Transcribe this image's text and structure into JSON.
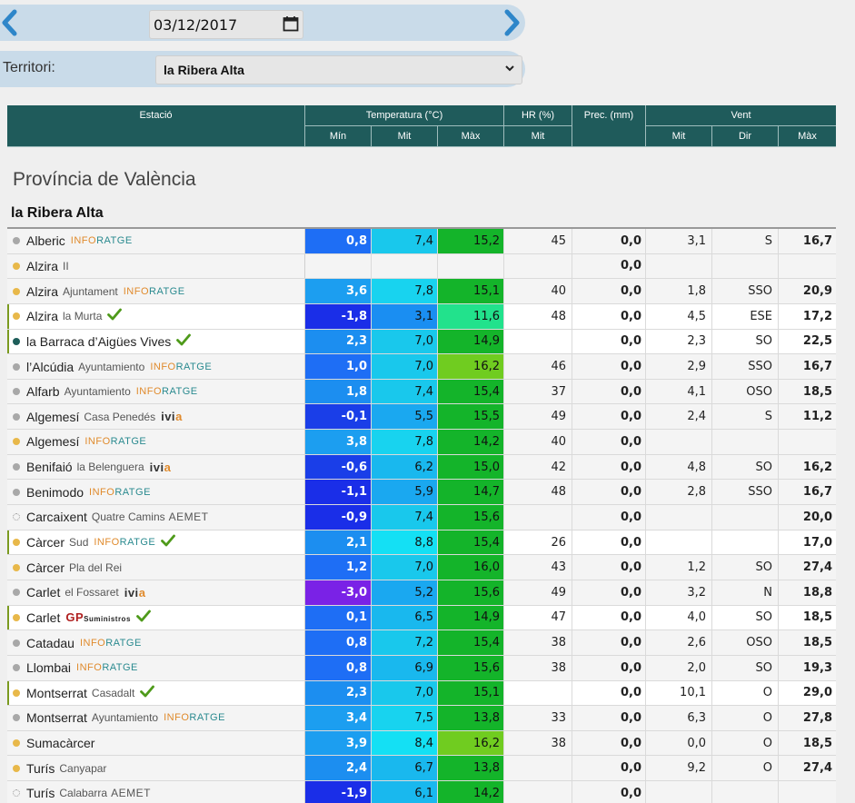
{
  "date": {
    "value": "03/12/2017"
  },
  "territory": {
    "label": "Territori:",
    "value": "la Ribera Alta"
  },
  "table_header": {
    "station": "Estació",
    "temperature": "Temperatura (°C)",
    "humidity": "HR (%)",
    "precip": "Prec. (mm)",
    "wind": "Vent",
    "min": "Mín",
    "mit": "Mit",
    "max": "Màx",
    "hr_mit": "Mit",
    "wind_mit": "Mit",
    "wind_dir": "Dir",
    "wind_max": "Màx"
  },
  "province": "Província de València",
  "comarca": "la Ribera Alta",
  "colors": {
    "header_bg": "#1f5b5b",
    "date_bar_bg": "#c9dbe9",
    "arrow": "#2e86c9",
    "dot_yellow": "#e8b84a",
    "dot_grey": "#a8a8a8",
    "dot_teal": "#1e5e5a",
    "check_green": "#4e9a1a"
  },
  "rows": [
    {
      "name": "Alberic",
      "sub": "",
      "net": "INFORATGE",
      "check": false,
      "hl": false,
      "dot": "grey",
      "tmin": "0,8",
      "tmit": "7,4",
      "tmax": "15,2",
      "hr": "45",
      "prec": "0,0",
      "vmit": "3,1",
      "vdir": "S",
      "vmax": "16,7",
      "cmin": "#1e6ef5",
      "cmit": "#19c8ec",
      "cmax": "#14b42a"
    },
    {
      "name": "Alzira",
      "sub": "II",
      "net": "",
      "check": false,
      "hl": false,
      "dot": "yellow",
      "tmin": "",
      "tmit": "",
      "tmax": "",
      "hr": "",
      "prec": "0,0",
      "vmit": "",
      "vdir": "",
      "vmax": "",
      "cmin": "",
      "cmit": "",
      "cmax": ""
    },
    {
      "name": "Alzira",
      "sub": "Ajuntament",
      "net": "INFORATGE",
      "check": false,
      "hl": false,
      "dot": "yellow",
      "tmin": "3,6",
      "tmit": "7,8",
      "tmax": "15,1",
      "hr": "40",
      "prec": "0,0",
      "vmit": "1,8",
      "vdir": "SSO",
      "vmax": "20,9",
      "cmin": "#1c9ef0",
      "cmit": "#18d3ef",
      "cmax": "#14b42a"
    },
    {
      "name": "Alzira",
      "sub": "la Murta",
      "net": "",
      "check": true,
      "hl": true,
      "dot": "yellow",
      "tmin": "-1,8",
      "tmit": "3,1",
      "tmax": "11,6",
      "hr": "48",
      "prec": "0,0",
      "vmit": "4,5",
      "vdir": "ESE",
      "vmax": "17,2",
      "cmin": "#1a2ee8",
      "cmit": "#1a8ef2",
      "cmax": "#22e28c"
    },
    {
      "name": "la Barraca d’Aigües Vives",
      "sub": "",
      "net": "",
      "check": true,
      "hl": true,
      "dot": "teal",
      "tmin": "2,3",
      "tmit": "7,0",
      "tmax": "14,9",
      "hr": "",
      "prec": "0,0",
      "vmit": "2,3",
      "vdir": "SO",
      "vmax": "22,5",
      "cmin": "#1c8ef0",
      "cmit": "#19c8ec",
      "cmax": "#14b42a"
    },
    {
      "name": "l’Alcúdia",
      "sub": "Ayuntamiento",
      "net": "INFORATGE",
      "check": false,
      "hl": false,
      "dot": "grey",
      "tmin": "1,0",
      "tmit": "7,0",
      "tmax": "16,2",
      "hr": "46",
      "prec": "0,0",
      "vmit": "2,9",
      "vdir": "SSO",
      "vmax": "16,7",
      "cmin": "#1e6ef5",
      "cmit": "#19c8ec",
      "cmax": "#70cc20"
    },
    {
      "name": "Alfarb",
      "sub": "Ayuntamiento",
      "net": "INFORATGE",
      "check": false,
      "hl": false,
      "dot": "grey",
      "tmin": "1,8",
      "tmit": "7,4",
      "tmax": "15,4",
      "hr": "37",
      "prec": "0,0",
      "vmit": "4,1",
      "vdir": "OSO",
      "vmax": "18,5",
      "cmin": "#1c8ef0",
      "cmit": "#19c8ec",
      "cmax": "#14b42a"
    },
    {
      "name": "Algemesí",
      "sub": "Casa Penedés",
      "net": "IVIA",
      "check": false,
      "hl": false,
      "dot": "grey",
      "tmin": "-0,1",
      "tmit": "5,5",
      "tmax": "15,5",
      "hr": "49",
      "prec": "0,0",
      "vmit": "2,4",
      "vdir": "S",
      "vmax": "11,2",
      "cmin": "#1a3ee8",
      "cmit": "#1aa8f0",
      "cmax": "#14b42a"
    },
    {
      "name": "Algemesí",
      "sub": "",
      "net": "INFORATGE",
      "check": false,
      "hl": false,
      "dot": "yellow",
      "tmin": "3,8",
      "tmit": "7,8",
      "tmax": "14,2",
      "hr": "40",
      "prec": "0,0",
      "vmit": "",
      "vdir": "",
      "vmax": "",
      "cmin": "#1c9ef0",
      "cmit": "#18d3ef",
      "cmax": "#14b42a"
    },
    {
      "name": "Benifaió",
      "sub": "la Belenguera",
      "net": "IVIA",
      "check": false,
      "hl": false,
      "dot": "grey",
      "tmin": "-0,6",
      "tmit": "6,2",
      "tmax": "15,0",
      "hr": "42",
      "prec": "0,0",
      "vmit": "4,8",
      "vdir": "SO",
      "vmax": "16,2",
      "cmin": "#1a3ee8",
      "cmit": "#19b8ee",
      "cmax": "#14b42a"
    },
    {
      "name": "Benimodo",
      "sub": "",
      "net": "INFORATGE",
      "check": false,
      "hl": false,
      "dot": "grey",
      "tmin": "-1,1",
      "tmit": "5,9",
      "tmax": "14,7",
      "hr": "48",
      "prec": "0,0",
      "vmit": "2,8",
      "vdir": "SSO",
      "vmax": "16,7",
      "cmin": "#1a2ee8",
      "cmit": "#1aa8f0",
      "cmax": "#14b42a"
    },
    {
      "name": "Carcaixent",
      "sub": "Quatre Camins",
      "net": "AEMET",
      "check": false,
      "hl": false,
      "dot": "hollow",
      "tmin": "-0,9",
      "tmit": "7,4",
      "tmax": "15,6",
      "hr": "",
      "prec": "0,0",
      "vmit": "",
      "vdir": "",
      "vmax": "20,0",
      "cmin": "#1a2ee8",
      "cmit": "#19c8ec",
      "cmax": "#14b42a"
    },
    {
      "name": "Càrcer",
      "sub": "Sud",
      "net": "INFORATGE",
      "check": true,
      "hl": true,
      "dot": "yellow",
      "tmin": "2,1",
      "tmit": "8,8",
      "tmax": "15,4",
      "hr": "26",
      "prec": "0,0",
      "vmit": "",
      "vdir": "",
      "vmax": "17,0",
      "cmin": "#1c8ef0",
      "cmit": "#14e0f4",
      "cmax": "#14b42a"
    },
    {
      "name": "Càrcer",
      "sub": "Pla del Rei",
      "net": "",
      "check": false,
      "hl": false,
      "dot": "yellow",
      "tmin": "1,2",
      "tmit": "7,0",
      "tmax": "16,0",
      "hr": "43",
      "prec": "0,0",
      "vmit": "1,2",
      "vdir": "SO",
      "vmax": "27,4",
      "cmin": "#1e6ef5",
      "cmit": "#19c8ec",
      "cmax": "#14b42a"
    },
    {
      "name": "Carlet",
      "sub": "el Fossaret",
      "net": "IVIA",
      "check": false,
      "hl": false,
      "dot": "grey",
      "tmin": "-3,0",
      "tmit": "5,2",
      "tmax": "15,6",
      "hr": "49",
      "prec": "0,0",
      "vmit": "3,2",
      "vdir": "N",
      "vmax": "18,8",
      "cmin": "#7a22e6",
      "cmit": "#1aa8f0",
      "cmax": "#14b42a"
    },
    {
      "name": "Carlet",
      "sub": "",
      "net": "GP",
      "check": true,
      "hl": true,
      "dot": "yellow",
      "tmin": "0,1",
      "tmit": "6,5",
      "tmax": "14,9",
      "hr": "47",
      "prec": "0,0",
      "vmit": "4,0",
      "vdir": "SO",
      "vmax": "18,5",
      "cmin": "#1e6ef5",
      "cmit": "#19b8ee",
      "cmax": "#14b42a"
    },
    {
      "name": "Catadau",
      "sub": "",
      "net": "INFORATGE",
      "check": false,
      "hl": false,
      "dot": "grey",
      "tmin": "0,8",
      "tmit": "7,2",
      "tmax": "15,4",
      "hr": "38",
      "prec": "0,0",
      "vmit": "2,6",
      "vdir": "OSO",
      "vmax": "18,5",
      "cmin": "#1e6ef5",
      "cmit": "#19c8ec",
      "cmax": "#14b42a"
    },
    {
      "name": "Llombai",
      "sub": "",
      "net": "INFORATGE",
      "check": false,
      "hl": false,
      "dot": "grey",
      "tmin": "0,8",
      "tmit": "6,9",
      "tmax": "15,6",
      "hr": "38",
      "prec": "0,0",
      "vmit": "2,0",
      "vdir": "SO",
      "vmax": "19,3",
      "cmin": "#1e6ef5",
      "cmit": "#19b8ee",
      "cmax": "#14b42a"
    },
    {
      "name": "Montserrat",
      "sub": "Casadalt",
      "net": "",
      "check": true,
      "hl": true,
      "dot": "yellow",
      "tmin": "2,3",
      "tmit": "7,0",
      "tmax": "15,1",
      "hr": "",
      "prec": "0,0",
      "vmit": "10,1",
      "vdir": "O",
      "vmax": "29,0",
      "cmin": "#1c8ef0",
      "cmit": "#19c8ec",
      "cmax": "#14b42a"
    },
    {
      "name": "Montserrat",
      "sub": "Ayuntamiento",
      "net": "INFORATGE",
      "check": false,
      "hl": false,
      "dot": "grey",
      "tmin": "3,4",
      "tmit": "7,5",
      "tmax": "13,8",
      "hr": "33",
      "prec": "0,0",
      "vmit": "6,3",
      "vdir": "O",
      "vmax": "27,8",
      "cmin": "#1c9ef0",
      "cmit": "#18d3ef",
      "cmax": "#14b42a"
    },
    {
      "name": "Sumacàrcer",
      "sub": "",
      "net": "",
      "check": false,
      "hl": false,
      "dot": "yellow",
      "tmin": "3,9",
      "tmit": "8,4",
      "tmax": "16,2",
      "hr": "38",
      "prec": "0,0",
      "vmit": "0,0",
      "vdir": "O",
      "vmax": "18,5",
      "cmin": "#1c9ef0",
      "cmit": "#14e0f4",
      "cmax": "#70cc20"
    },
    {
      "name": "Turís",
      "sub": "Canyapar",
      "net": "",
      "check": false,
      "hl": false,
      "dot": "yellow",
      "tmin": "2,4",
      "tmit": "6,7",
      "tmax": "13,8",
      "hr": "",
      "prec": "0,0",
      "vmit": "9,2",
      "vdir": "O",
      "vmax": "27,4",
      "cmin": "#1c8ef0",
      "cmit": "#19b8ee",
      "cmax": "#14b42a"
    },
    {
      "name": "Turís",
      "sub": "Calabarra",
      "net": "AEMET",
      "check": false,
      "hl": false,
      "dot": "hollow",
      "tmin": "-1,9",
      "tmit": "6,1",
      "tmax": "14,2",
      "hr": "",
      "prec": "0,0",
      "vmit": "",
      "vdir": "",
      "vmax": "",
      "cmin": "#1a2ee8",
      "cmit": "#19b8ee",
      "cmax": "#14b42a"
    }
  ]
}
